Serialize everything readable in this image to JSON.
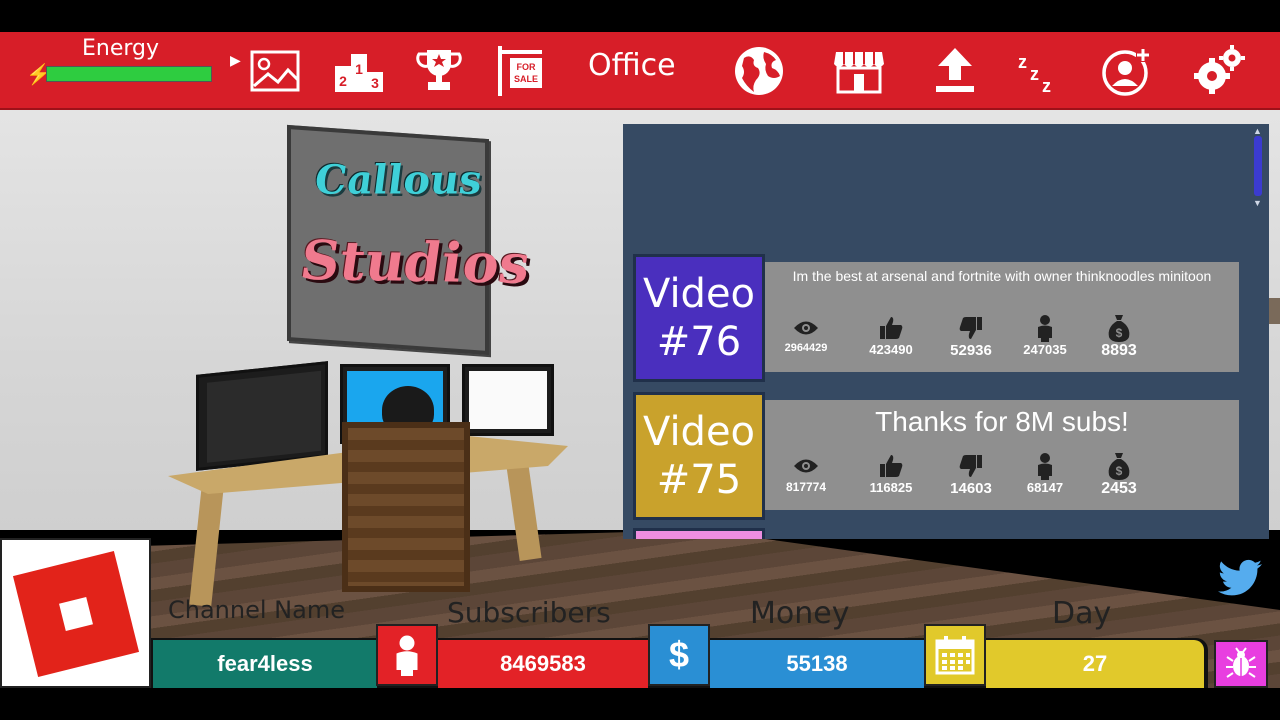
{
  "topbar": {
    "energy_label": "Energy",
    "energy_level": 1.0,
    "location_label": "Office",
    "icons": [
      "bolt-icon",
      "arrow-right-icon",
      "thumbnail-icon",
      "leaderboard-icon",
      "trophy-icon",
      "for-sale-sign-icon",
      "globe-icon",
      "shop-icon",
      "upload-icon",
      "sleep-icon",
      "add-friend-icon",
      "settings-icon"
    ],
    "sign_text": "FOR SALE",
    "podium_digits": [
      "2",
      "1",
      "3"
    ]
  },
  "scene": {
    "poster_line1": "Callous",
    "poster_line2": "Studios"
  },
  "videos": [
    {
      "label_word": "Video",
      "label_number": "#76",
      "color": "#4a2fbe",
      "title": "Im the best at arsenal and fortnite with owner thinknoodles minitoon",
      "views": "2964429",
      "likes": "423490",
      "dislikes": "52936",
      "subs": "247035",
      "money": "8893"
    },
    {
      "label_word": "Video",
      "label_number": "#75",
      "color": "#c9a22c",
      "title": "Thanks for 8M subs!",
      "views": "817774",
      "likes": "116825",
      "dislikes": "14603",
      "subs": "68147",
      "money": "2453"
    }
  ],
  "stats": {
    "channel_title": "Channel Name",
    "channel_value": "fear4less",
    "subscribers_title": "Subscribers",
    "subscribers_value": "8469583",
    "money_title": "Money",
    "money_symbol": "$",
    "money_value": "55138",
    "day_title": "Day",
    "day_value": "27"
  },
  "colors": {
    "topbar": "#d71e28",
    "channel": "#127a6a",
    "subscribers": "#e32227",
    "money": "#2a8fd4",
    "day": "#e1c92b",
    "bug": "#e83ee0"
  }
}
